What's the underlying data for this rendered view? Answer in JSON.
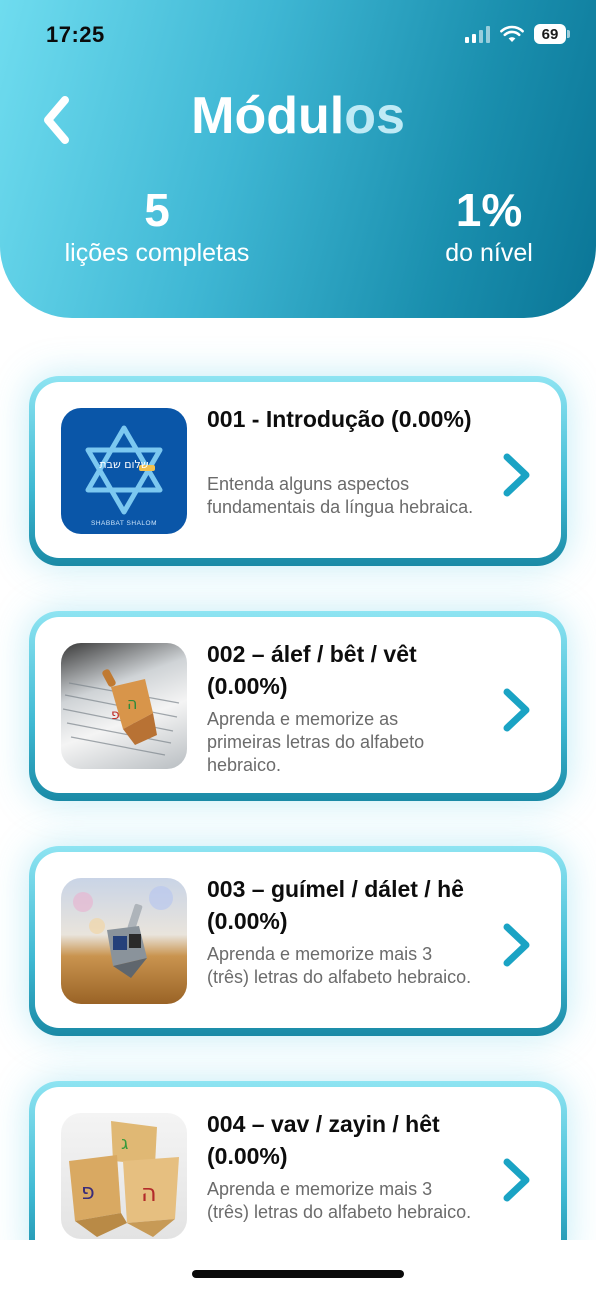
{
  "status": {
    "time": "17:25",
    "battery": "69"
  },
  "header": {
    "title_main": "Módul",
    "title_fade": "os",
    "stats": [
      {
        "value": "5",
        "label": "lições completas"
      },
      {
        "value": "1%",
        "label": "do nível"
      }
    ]
  },
  "modules": [
    {
      "title": "001 - Introdução (0.00%)",
      "description": "Entenda alguns aspectos fundamentais da língua hebraica.",
      "thumb_caption": "SHABBAT SHALOM",
      "thumb_text": "שלום שבת"
    },
    {
      "title": "002 – álef / bêt / vêt (0.00%)",
      "description": "Aprenda e memorize as primeiras letras do alfabeto hebraico."
    },
    {
      "title": "003 – guímel / dálet / hê (0.00%)",
      "description": "Aprenda e memorize mais 3 (três) letras do alfabeto hebraico."
    },
    {
      "title": "004 – vav / zayin / hêt (0.00%)",
      "description": "Aprenda e memorize mais 3 (três) letras do alfabeto hebraico."
    }
  ],
  "colors": {
    "accent": "#1aa3c4",
    "header_dark": "#0a7596",
    "header_light": "#6fdcef"
  }
}
